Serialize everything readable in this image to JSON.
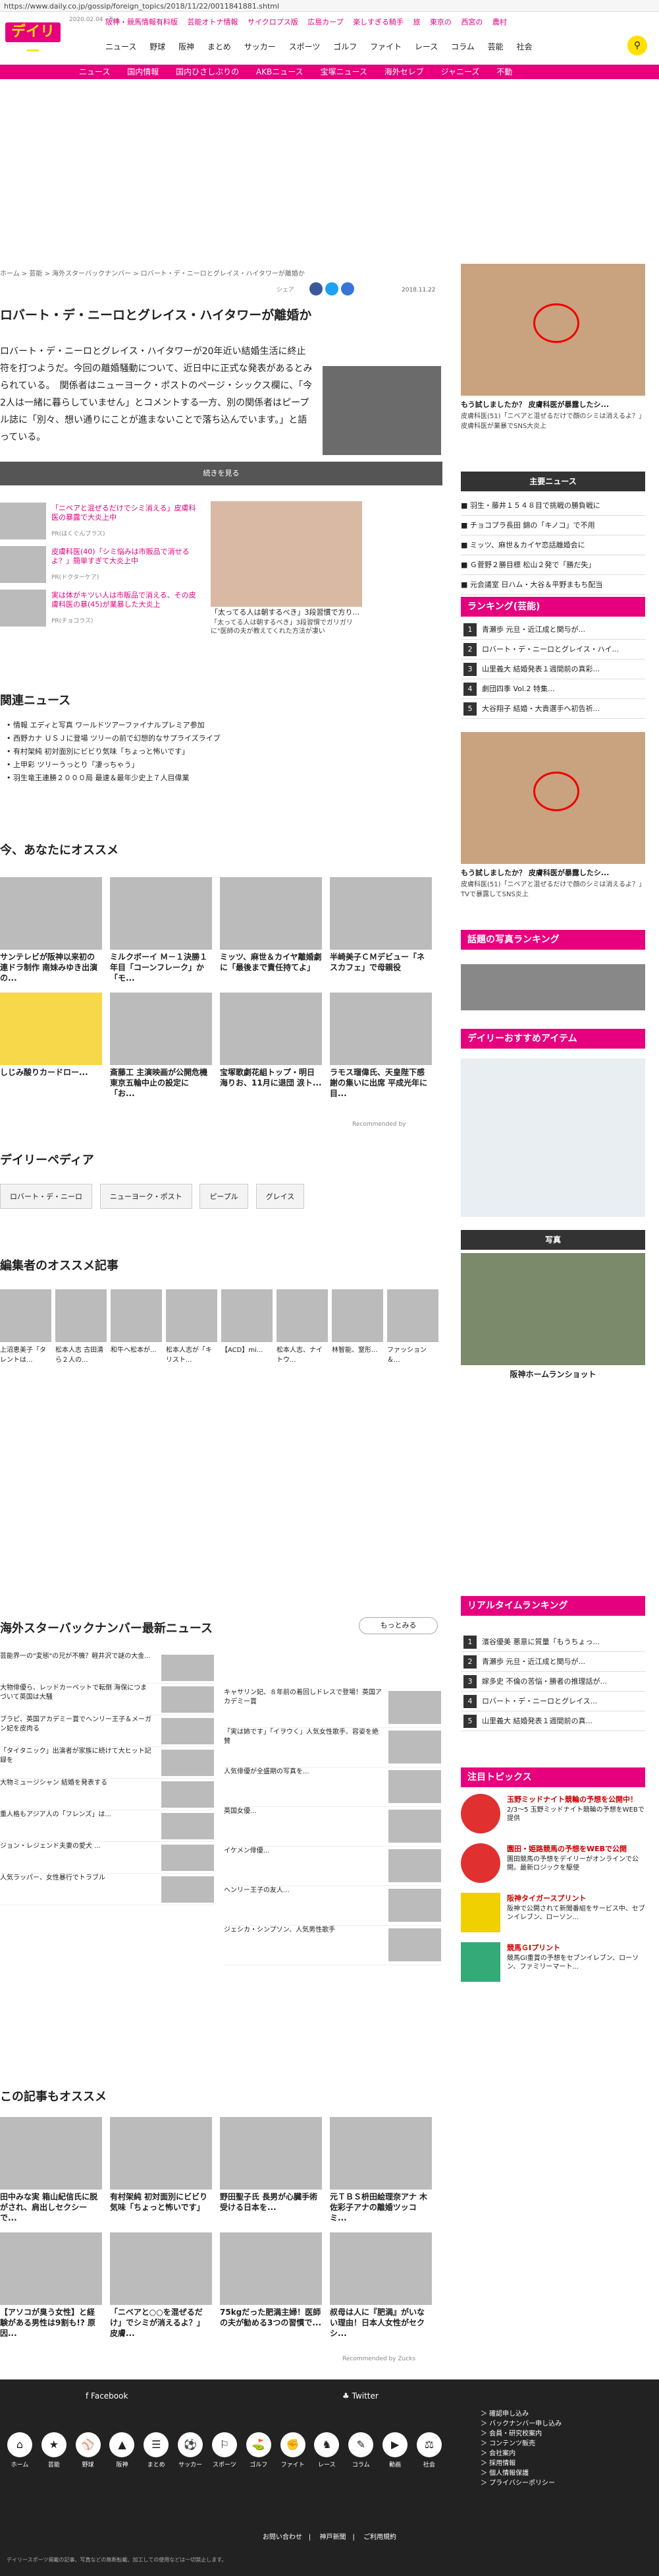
{
  "browser": {
    "url": "https://www.daily.co.jp/gossip/foreign_topics/2018/11/22/0011841881.shtml"
  },
  "header": {
    "logo": "デイリー",
    "date": "2020.02.04 - Tue",
    "topnav": [
      "阪神・競馬情報有料版",
      "芸能オトナ情報",
      "サイクロプス版",
      "広島カープ",
      "楽しすぎる騎手",
      "旅",
      "東京の",
      "西宮の",
      "農村"
    ],
    "mainnav": [
      "ニュース",
      "野球",
      "阪神",
      "まとめ",
      "サッカー",
      "スポーツ",
      "ゴルフ",
      "ファイト",
      "レース",
      "コラム",
      "芸能",
      "社会"
    ],
    "pinkbar": [
      "ニュース",
      "国内情報",
      "国内ひさしぶりの",
      "AKBニュース",
      "宝塚ニュース",
      "海外セレブ",
      "ジャニーズ",
      "不動"
    ]
  },
  "article": {
    "breadcrumb": "ホーム > 芸能 > 海外スターバックナンバー > ロバート・デ・ニーロとグレイス・ハイタワーが離婚か",
    "share": "シェア",
    "date": "2018.11.22",
    "title": "ロバート・デ・ニーロとグレイス・ハイタワーが離婚か",
    "lead": "ロバート・デ・ニーロとグレイス・ハイタワーが20年近い結婚生活に終止符を打つようだ。今回の離婚騒動について、近日中に正式な発表があるとみられている。　関係者はニューヨーク・ポストのページ・シックス欄に、「今2人は一緒に暮らしていません」とコメントする一方、別の関係者はピープル誌に「別々、想い通りにことが進まないことで落ち込んでいます。」と語っている。",
    "more": "続きを見る"
  },
  "promo": [
    {
      "title": "「ニベアと混ぜるだけでシミ消える」皮膚科医の暴露で大炎上中",
      "src": "PR(はくぐんブラス)"
    },
    {
      "title": "皮膚科医(40)「シミ悩みは市販品で消せるよ？」簡単すぎて大炎上中",
      "src": "PR(ドクターケア)"
    },
    {
      "title": "実は体がキツい人は市販品で消える、その皮膚科医の暴(45)が業暴した大炎上",
      "src": "PR(チョコラス)"
    }
  ],
  "promo_big": {
    "title": "「太ってる人は朝するべき」3段習慣で方り...",
    "sub": "「太ってる人は朝するべき」3段習慣でガリガリに\"医師の夫が教えてくれた方法が凄い"
  },
  "related": {
    "heading": "関連ニュース",
    "items": [
      "情報 エディと写真 ワールドツアーファイナルプレミア参加",
      "西野カナ ＵＳＪに登場 ツリーの前で幻想的なサプライズライブ",
      "有村架純 初対面別にビビり気味「ちょっと怖いです」",
      "上甲彩 ツリーうっとり「凄っちゃう」",
      "羽生竜王連勝２０００局 最速＆最年少史上７人目偉業"
    ]
  },
  "osusume": {
    "heading": "今、あなたにオススメ",
    "cards": [
      "サンテレビが阪神以来初の連ドラ制作 南妹みゆき出演の...",
      "ミルクボーイ Ｍ－１決勝１年目「コーンフレーク」か「モ...",
      "ミッツ、麻世＆カイヤ離婚劇に「最後まで責任持てよ」",
      "半崎美子ＣＭデビュー「ネスカフェ」で母親役",
      "しじみ酸りカードロー...",
      "斎藤工 主演映画が公開危機 東京五輪中止の設定に「お...",
      "宝塚歌劇花組トップ・明日海りお、11月に退団 涙ト...",
      "ラモス瑠偉氏、天皇陛下感謝の集いに出席 平成光年に目..."
    ],
    "rec": "Recommended by"
  },
  "pedia": {
    "heading": "デイリーペディア",
    "tags": [
      "ロバート・デ・ニーロ",
      "ニューヨーク・ポスト",
      "ピープル",
      "グレイス"
    ]
  },
  "editor": {
    "heading": "編集者のオススメ記事",
    "cards": [
      "上沼恵美子「タレントは...",
      "松本人志 古田清ら２人の...",
      "和牛へ松本が...",
      "松本人志が「キリスト...",
      "【ACD】mi...",
      "松本人志、ナイトウ...",
      "林智能、窒形...",
      "ファッション＆..."
    ]
  },
  "backnumber": {
    "heading": "海外スターバックナンバー最新ニュース",
    "more": "もっとみる",
    "left": [
      "芸能界一の\"変態\"の兄が不機？軽井沢で謎の大金...",
      "大物俳優ら、レッドカーペットで転倒 海保につまづいて英国は大騒",
      "ブラピ、英国アカデミー賞でヘンリー王子＆メーガン妃を皮肉る",
      "「タイタニック」出演者が家族に続けて大ヒット記録を",
      "大物ミュージシャン 結婚を発表する",
      "重人格もアジア人の「フレンズ」は...",
      "ジョン・レジェンド夫妻の愛犬 ...",
      "人気ラッパー、女性暴行でトラブル"
    ],
    "right": [
      "キャサリン妃、８年前の着回しドレスで登場！英国アカデミー賞",
      "「実は姉です」「イヲウく」人気女性歌手、容姿を絶賛",
      "人気俳優が全盛期の写真を...",
      "英国女優...",
      "イケメン俳優...",
      "ヘンリー王子の友人...",
      "ジェシカ・シンプソン、人気男性歌手"
    ]
  },
  "related2": {
    "heading": "この記事もオススメ",
    "cards": [
      "田中みな実 箱山紀信氏に脱がされ、肩出しセクシーで...",
      "有村架純 初対面別にビビり気味「ちょっと怖いです」",
      "野田聖子氏 長男が心臓手術受ける日本を...",
      "元ＴＢＳ枡田絵理奈アナ 木佐彩子アナの離婚ツッコミ...",
      "【アソコが臭う女性】と経験がある男性は9割も!? 原因...",
      "「ニベアと○○を混ぜるだけ」でシミが消えるよ？」皮膚...",
      "75kgだった肥満主婦！医師の夫が勧める3つの習慣で...",
      "叔母は人に『肥満』がいない理由！日本人女性がセクシ..."
    ],
    "rec": "Recommended by Zucks"
  },
  "right": {
    "ad1_title": "もう試しましたか？ 皮膚科医が暴露したシ...",
    "ad1_sub": "皮膚科医(51)「ニベアと混ぜるだけで顔のシミは消えるよ？」皮膚科医が業暴でSNS大炎上",
    "main_heading": "主要ニュース",
    "main_items": [
      "羽生・藤井１５４８目で挑戦の勝負戦に",
      "チョコプラ長田 錦の「キノコ」で不用",
      "ミッツ、麻世＆カイヤ恋話離婚会に",
      "Ｇ菅野２勝目標 松山２発で「勝だ失」",
      "元会議室 日ハム・大谷＆平野まもち配当"
    ],
    "ranking_heading": "ランキング(芸能)",
    "ranking": [
      "青瀬歩 元旦・近江成と関与が...",
      "ロバート・デ・ニーロとグレイス・ハイ...",
      "山里義大 結婚発表１週間前の真彩...",
      "劇団四季 Vol.2 特集...",
      "大谷翔子 結婚・大貴選手へ初告祈..."
    ],
    "ad2_title": "もう試しましたか？ 皮膚科医が暴露したシ...",
    "ad2_sub": "皮膚科医(51)「ニベアと混ぜるだけで顔のシミは消えるよ？」TVで暴露してSNS炎上",
    "photo_rank_heading": "話題の写真ランキング",
    "items_heading": "デイリーおすすめアイテム",
    "photo_heading": "写真",
    "photo_caption": "阪神ホームランショット",
    "realtime_heading": "リアルタイムランキング",
    "realtime": [
      "濱谷優美 悪意に質量「もうちょっ...",
      "青瀬歩 元旦・近江成と関与が...",
      "嫁多史 不倫の苦悩・勝者の推理話が...",
      "ロバート・デ・ニーロとグレイス...",
      "山里義大 結婚発表１週間前の真..."
    ],
    "topics_heading": "注目トピックス",
    "topics": [
      {
        "t": "玉野ミッドナイト競輪の予想を公開中！",
        "d": "2/3～5 玉野ミッドナイト競輪の予想をWEBで提供"
      },
      {
        "t": "園田・姫路競馬の予想をWEBで公開",
        "d": "園田競馬の予想をデイリーがオンラインで公開。最新ロジックを駆使"
      },
      {
        "t": "阪神タイガースプリント",
        "d": "阪神で公開されて新聞番組をサービス中、セブンイレブン、ローソン..."
      },
      {
        "t": "競馬ＧⅠプリント",
        "d": "競馬GⅠ重賞の予想をセブンイレブン、ローソン、ファミリーマート..."
      }
    ]
  },
  "footer": {
    "facebook": "Facebook",
    "twitter": "Twitter",
    "icons": [
      "ホーム",
      "芸能",
      "野球",
      "阪神",
      "まとめ",
      "サッカー",
      "スポーツ",
      "ゴルフ",
      "ファイト",
      "レース",
      "コラム",
      "動画",
      "社会"
    ],
    "links": [
      "＞ 確認申し込み",
      "＞ バックナンバー申し込み",
      "＞ 会員・研究校案内",
      "＞ コンテンツ販売",
      "＞ 会社案内",
      "＞ 採用情報",
      "＞ 個人情報保護",
      "＞ プライバシーポリシー"
    ],
    "bottom": [
      "お問い合わせ",
      "神戸新聞",
      "ご利用規約"
    ],
    "copy": "デイリースポーツ掲載の記事、写真などの無断転載、加工しての使用などは一切禁止します。"
  }
}
